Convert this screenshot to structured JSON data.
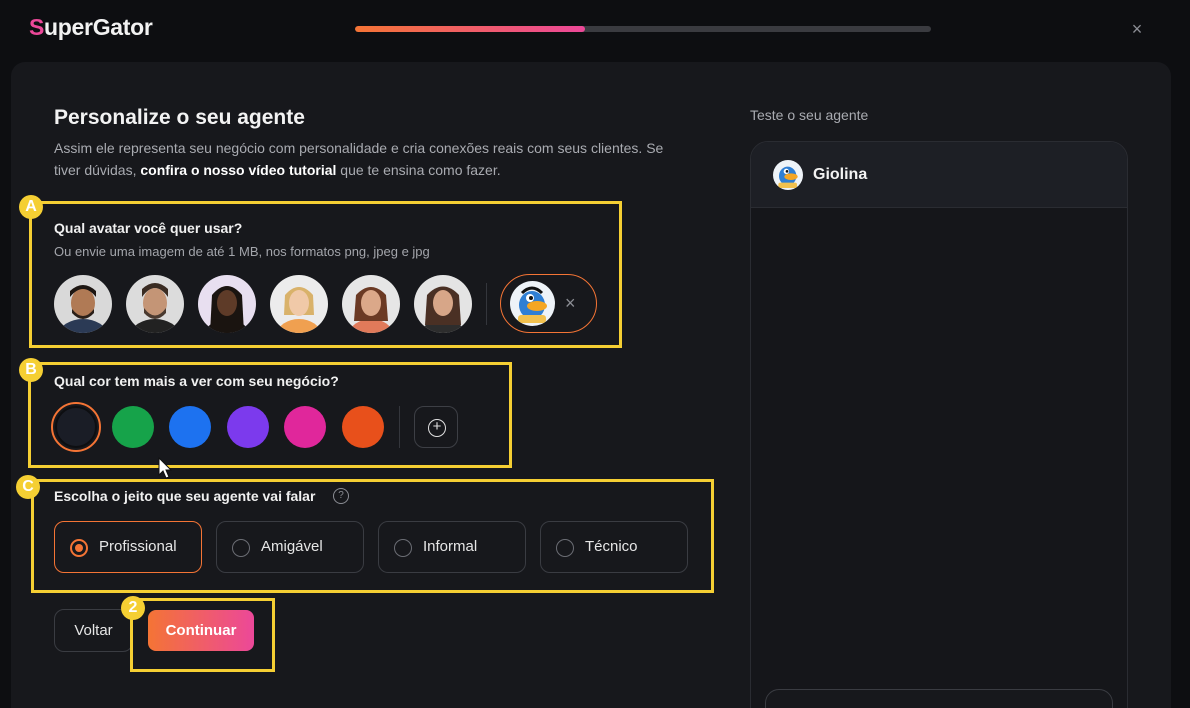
{
  "header": {
    "logo_first": "S",
    "logo_rest": "uperGator",
    "progress_fraction": 0.4,
    "close_label": "×"
  },
  "main": {
    "title": "Personalize o seu agente",
    "desc_part1": "Assim ele representa seu negócio com personalidade e cria conexões reais com seus clientes. Se tiver dúvidas, ",
    "desc_link": "confira o nosso vídeo tutorial",
    "desc_part2": " que te ensina como fazer."
  },
  "avatar_section": {
    "badge": "A",
    "question": "Qual avatar você quer usar?",
    "hint": "Ou envie uma imagem de até 1 MB, nos formatos png, jpeg e jpg",
    "remove_label": "×"
  },
  "color_section": {
    "badge": "B",
    "question": "Qual cor tem mais a ver com seu negócio?",
    "colors": [
      "#1a1d26",
      "#16a34a",
      "#1d72f0",
      "#7c3aed",
      "#e0279b",
      "#e8501b"
    ],
    "selected_color": "#1a1d26",
    "add_label": "+"
  },
  "tone_section": {
    "badge": "C",
    "question": "Escolha o jeito que seu agente vai falar",
    "help_label": "?",
    "options": [
      "Profissional",
      "Amigável",
      "Informal",
      "Técnico"
    ],
    "selected": "Profissional"
  },
  "footer": {
    "badge": "2",
    "back_label": "Voltar",
    "continue_label": "Continuar"
  },
  "preview": {
    "label": "Teste o seu agente",
    "agent_name": "Giolina"
  },
  "colors": {
    "accent_orange": "#f47435",
    "accent_pink": "#ec4899",
    "highlight_yellow": "#f5cf33"
  }
}
